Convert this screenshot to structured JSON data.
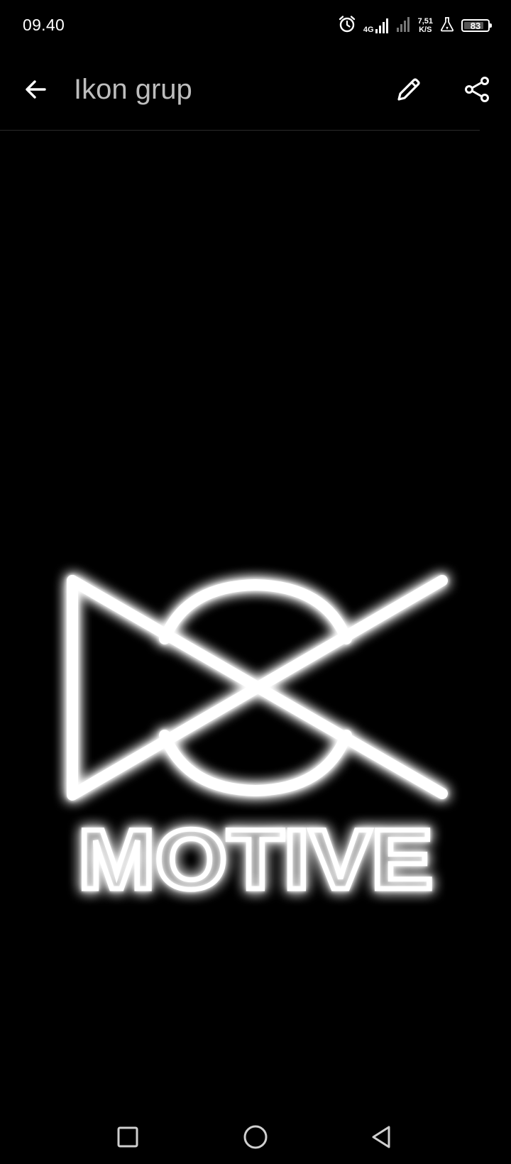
{
  "status_bar": {
    "time": "09.40",
    "network_type": "4G",
    "speed_value": "7,51",
    "speed_unit": "K/S",
    "battery_level": "83",
    "battery_percent": 83,
    "icons": [
      "alarm-icon",
      "signal-icon",
      "signal-icon",
      "flask-icon",
      "battery-icon"
    ]
  },
  "app_bar": {
    "title": "Ikon grup",
    "icons": [
      "back-arrow-icon",
      "pencil-icon",
      "share-icon"
    ]
  },
  "image": {
    "logo_text": "MOTIVE",
    "colors": {
      "background": "#000000",
      "neon": "#ffffff"
    }
  },
  "nav_bar": {
    "icons": [
      "square-icon",
      "circle-icon",
      "triangle-back-icon"
    ]
  }
}
